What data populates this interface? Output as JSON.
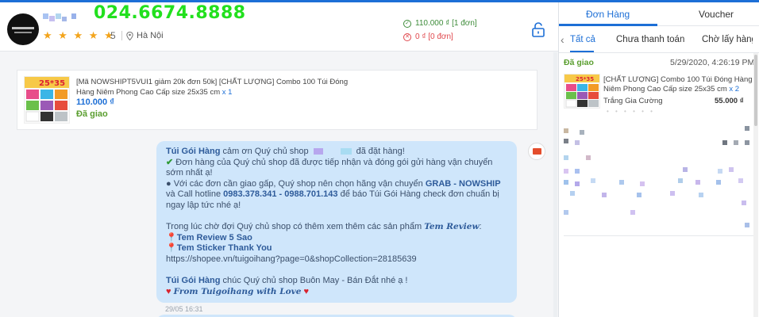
{
  "header": {
    "shop_phone": "024.6674.8888",
    "stars": "★ ★ ★ ★ ★",
    "rating": "5",
    "location": "Hà Nội",
    "stats": [
      {
        "label": "110.000 ₫ [1 đơn]",
        "kind": "success"
      },
      {
        "label": "0 ₫ [0 đơn]",
        "kind": "cancel"
      }
    ]
  },
  "product_card": {
    "title": "[Mã NOWSHIPT5VUI1 giảm 20k đơn 50k] [CHẤT LƯỢNG] Combo 100 Túi Đóng Hàng Niêm Phong Cao Cấp size 25x35 cm",
    "qty": "x 1",
    "price": "110.000 ₫",
    "status": "Đã giao"
  },
  "chat": {
    "line1_brand": "Túi Gói Hàng",
    "line1_a": "cảm ơn Quý chủ shop",
    "line1_b": "đã đặt hàng!",
    "line2": "Đơn hàng của Quý chủ shop đã được tiếp nhận và đóng gói gửi hàng vận chuyển sớm nhất ạ!",
    "line3_a": "● Với các đơn cần giao gấp, Quý shop nên chọn hãng vận chuyển",
    "line3_carrier": "GRAB - NOWSHIP",
    "line3_b": "và Call hotline",
    "line3_hotline": "0983.378.341 - 0988.701.143",
    "line3_c": "để báo Túi Gói Hàng check đơn chuẩn bị ngay lập tức nhé ạ!",
    "line4_a": "Trong lúc chờ đợi Quý chủ shop có thêm xem thêm các sản phẩm",
    "line4_sig": "Tem Review",
    "line4_b": ":",
    "item1": "Tem Review 5 Sao",
    "item2": "Tem Sticker Thank You",
    "url": "https://shopee.vn/tuigoihang?page=0&shopCollection=28185639",
    "line5_brand": "Túi Gói Hàng",
    "line5": "chúc Quý chủ shop Buôn May - Bán Đắt nhé ạ !",
    "sign_off": "From Tuigoihang with Love",
    "timestamp": "29/05 16:31"
  },
  "right_panel": {
    "tabs": [
      "Đơn Hàng",
      "Voucher"
    ],
    "active_tab": "Đơn Hàng",
    "subtabs": [
      "Tất cả",
      "Chưa thanh toán",
      "Chờ lấy hàng"
    ],
    "active_subtab": "Tất cả",
    "order": {
      "status": "Đã giao",
      "date": "5/29/2020, 4:26:19 PM",
      "title": "[CHẤT LƯỢNG] Combo 100 Túi Đóng Hàng Niêm Phong Cao Cấp size 25x35 cm",
      "qty": "x 2",
      "buyer": "Trắng Gia Cường",
      "amount": "55.000 ₫",
      "dots": "• • • • • •"
    }
  },
  "colors": {
    "accent": "#1d6fd6",
    "success": "#5a9e2f",
    "danger": "#e0474c",
    "bubble": "#cfe6fb",
    "phone_green": "#22e01e",
    "stars": "#f3a41b"
  },
  "icons": [
    "location-pin-icon",
    "check-circle-icon",
    "cancel-circle-icon",
    "unlock-icon",
    "check-mark-icon",
    "pushpin-icon",
    "heart-icon",
    "chevron-left-icon",
    "bot-avatar-icon"
  ]
}
